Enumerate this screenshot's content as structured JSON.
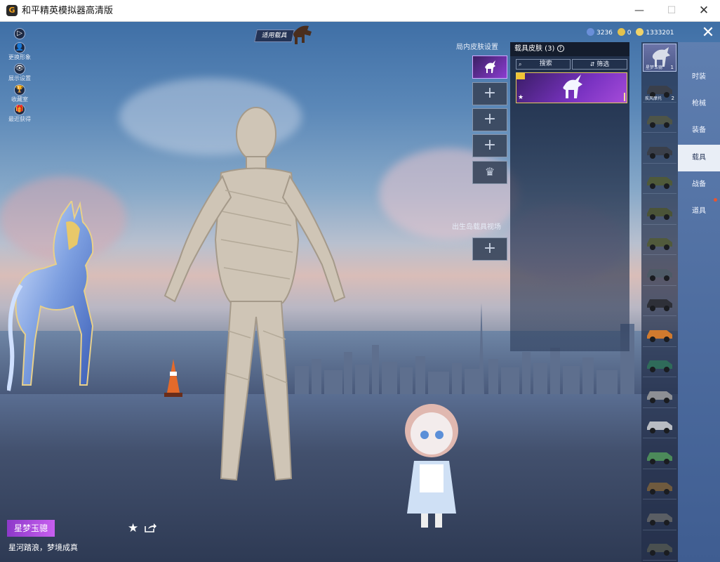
{
  "window": {
    "title": "和平精英模拟器高清版",
    "logo_glyph": "G",
    "minimize_glyph": "—",
    "maximize_glyph": "☐",
    "close_glyph": "✕"
  },
  "left_menu": [
    {
      "label": "更换形象",
      "icon": "person-icon",
      "glyph": "👤"
    },
    {
      "label": "展示设置",
      "icon": "eye-icon",
      "glyph": "👁"
    },
    {
      "label": "收藏室",
      "icon": "trophy-icon",
      "glyph": "🏆"
    },
    {
      "label": "最近获得",
      "icon": "gift-icon",
      "glyph": "🎁"
    }
  ],
  "top": {
    "vehicle_tag": "适用载具",
    "currencies": [
      {
        "value": "3236",
        "color": "#6a8fd9",
        "icon": "diamond-coin-icon"
      },
      {
        "value": "0",
        "color": "#e3c24e",
        "icon": "gold-coin-icon"
      },
      {
        "value": "1333201",
        "color": "#f0d36a",
        "icon": "bp-coin-icon"
      }
    ],
    "close_glyph": "✕"
  },
  "slots": {
    "skin_setting_label": "局内皮肤设置",
    "spawn_label": "出生岛载具视场",
    "plus_glyph": "+",
    "crown_glyph": "♛"
  },
  "skin_panel": {
    "title": "载具皮肤 (3)",
    "help_glyph": "?",
    "search_label": "搜索",
    "filter_label": "筛选",
    "card_star": "★"
  },
  "vehicles": [
    {
      "name": "星梦玉骢",
      "count": "1",
      "active": true
    },
    {
      "name": "疾风摩托",
      "count": "2",
      "active": false
    },
    {
      "name": "",
      "count": "",
      "active": false
    },
    {
      "name": "",
      "count": "",
      "active": false
    },
    {
      "name": "",
      "count": "",
      "active": false
    },
    {
      "name": "",
      "count": "",
      "active": false
    },
    {
      "name": "",
      "count": "",
      "active": false
    },
    {
      "name": "",
      "count": "",
      "active": false
    },
    {
      "name": "",
      "count": "",
      "active": false
    },
    {
      "name": "",
      "count": "",
      "active": false
    },
    {
      "name": "",
      "count": "",
      "active": false
    },
    {
      "name": "",
      "count": "",
      "active": false
    },
    {
      "name": "",
      "count": "",
      "active": false
    },
    {
      "name": "",
      "count": "",
      "active": false
    },
    {
      "name": "",
      "count": "",
      "active": false
    },
    {
      "name": "",
      "count": "",
      "active": false
    },
    {
      "name": "",
      "count": "",
      "active": false
    }
  ],
  "categories": [
    {
      "label": "时装",
      "active": false
    },
    {
      "label": "枪械",
      "active": false
    },
    {
      "label": "装备",
      "active": false
    },
    {
      "label": "载具",
      "active": true
    },
    {
      "label": "战备",
      "active": false
    },
    {
      "label": "道具",
      "active": false
    }
  ],
  "bottom": {
    "skin_name": "星梦玉骢",
    "slogan": "星河踏浪，梦境成真",
    "favorite_glyph": "★"
  },
  "colors": {
    "accent_purple": "#8d39c9",
    "panel_blue": "#4a6596",
    "gold": "#e8c95a"
  }
}
